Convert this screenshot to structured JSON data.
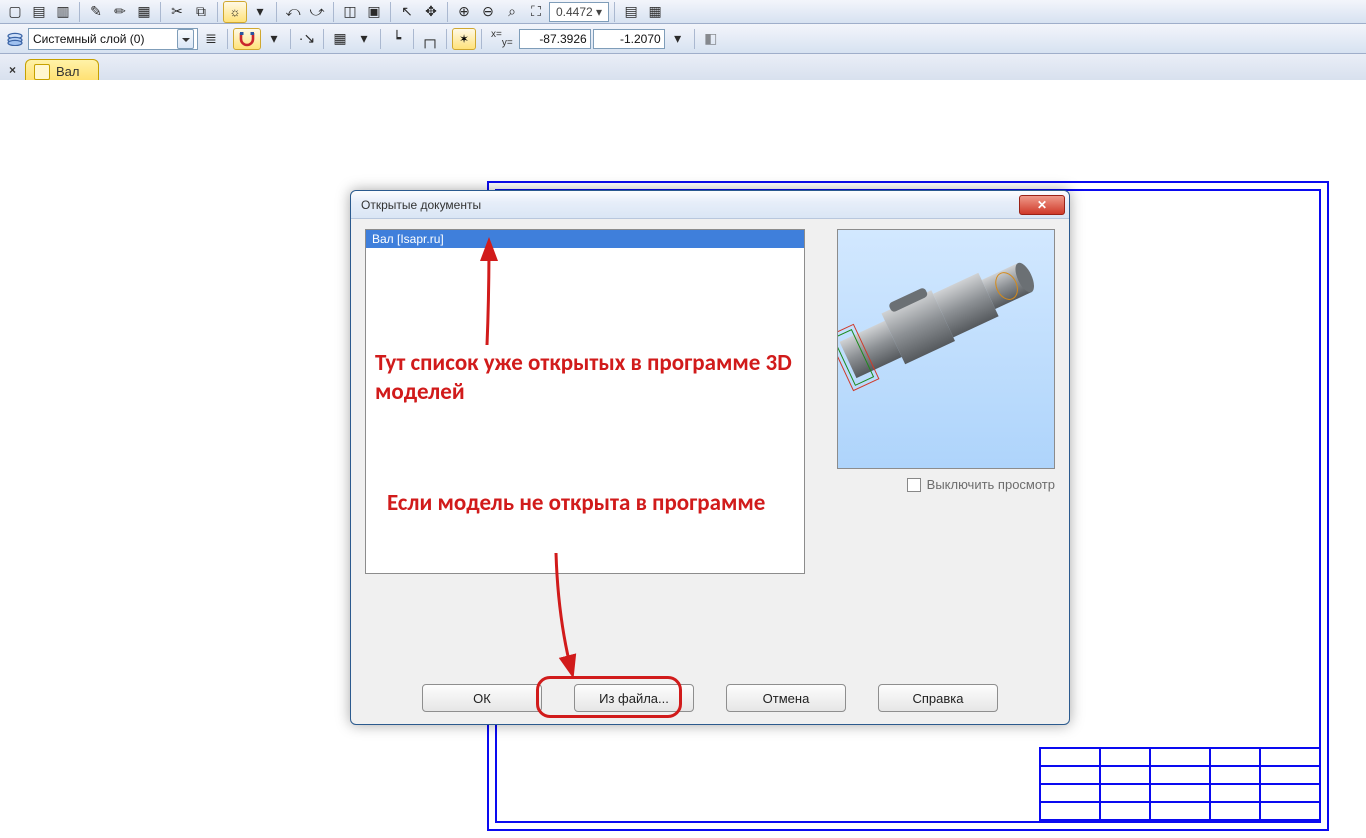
{
  "toolbar": {
    "zoom_value": "0.4472",
    "layer_name": "Системный слой (0)",
    "coord_x": "-87.3926",
    "coord_y": "-1.2070",
    "xy_prefix": "x= y="
  },
  "tab": {
    "label": "Вал"
  },
  "dialog": {
    "title": "Открытые документы",
    "list_item": "Вал [Isapr.ru]",
    "disable_preview": "Выключить просмотр",
    "ok": "ОК",
    "from_file": "Из файла...",
    "cancel": "Отмена",
    "help": "Справка"
  },
  "annotations": {
    "list_note": "Тут список уже открытых в программе 3D моделей",
    "file_note": "Если модель не открыта в программе"
  }
}
